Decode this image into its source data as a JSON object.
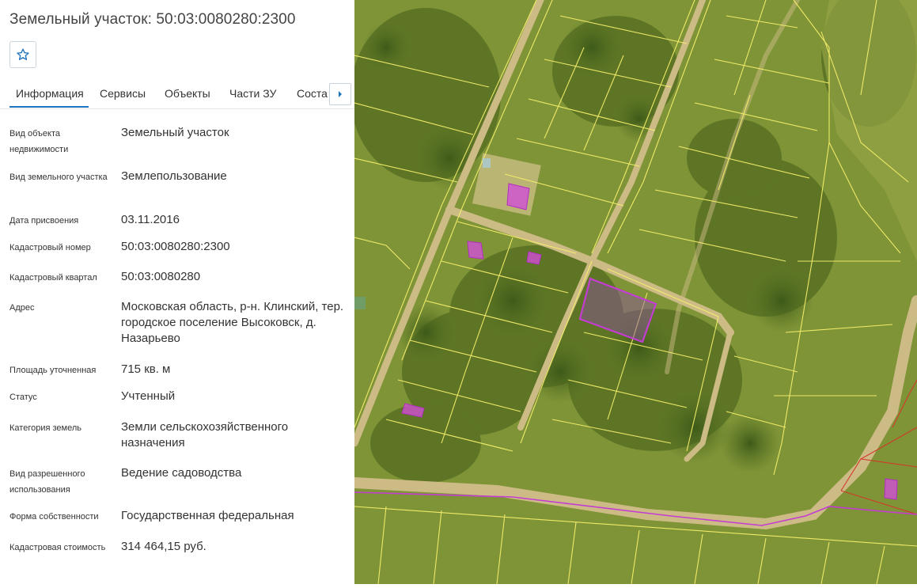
{
  "panel": {
    "title": "Земельный участок: 50:03:0080280:2300",
    "favorite_icon": "star-outline-icon",
    "tabs": [
      {
        "label": "Информация",
        "active": true
      },
      {
        "label": "Сервисы"
      },
      {
        "label": "Объекты"
      },
      {
        "label": "Части ЗУ"
      },
      {
        "label": "Состав"
      }
    ],
    "next_tab_icon": "chevron-right-icon",
    "fields": [
      {
        "label": "Вид объекта недвижимости",
        "value": "Земельный участок"
      },
      {
        "label": "Вид земельного участка",
        "value": "Землепользование"
      },
      {
        "label": "Дата присвоения",
        "value": "03.11.2016"
      },
      {
        "label": "Кадастровый номер",
        "value": "50:03:0080280:2300"
      },
      {
        "label": "Кадастровый квартал",
        "value": "50:03:0080280"
      },
      {
        "label": "Адрес",
        "value": "Московская область, р-н. Клинский, тер. городское поселение Высоковск, д. Назарьево"
      },
      {
        "label": "Площадь уточненная",
        "value": "715 кв. м"
      },
      {
        "label": "Статус",
        "value": "Учтенный"
      },
      {
        "label": "Категория земель",
        "value": "Земли сельскохозяйственного назначения"
      },
      {
        "label": "Вид разрешенного использования",
        "value": "Ведение садоводства"
      },
      {
        "label": "Форма собственности",
        "value": "Государственная федеральная"
      },
      {
        "label": "Кадастровая стоимость",
        "value": "314 464,15 руб."
      }
    ]
  },
  "colors": {
    "accent": "#1e73be",
    "parcel_line": "#f4ee6a",
    "selected_parcel": "#c43dd1",
    "building": "#d24fd6"
  }
}
